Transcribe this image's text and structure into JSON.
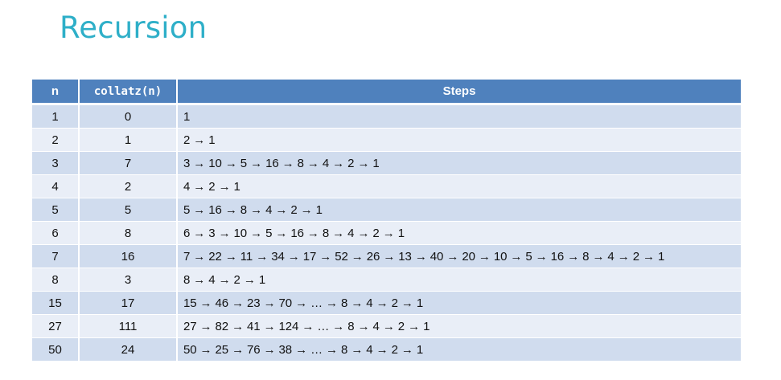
{
  "title": "Recursion",
  "table": {
    "headers": [
      "n",
      "collatz(n)",
      "Steps"
    ],
    "rows": [
      {
        "n": "1",
        "collatz": "0",
        "steps": "1"
      },
      {
        "n": "2",
        "collatz": "1",
        "steps": "2 → 1"
      },
      {
        "n": "3",
        "collatz": "7",
        "steps": "3 → 10 → 5 → 16 → 8 → 4 → 2 → 1"
      },
      {
        "n": "4",
        "collatz": "2",
        "steps": "4 → 2 → 1"
      },
      {
        "n": "5",
        "collatz": "5",
        "steps": "5 → 16 → 8 → 4 → 2 → 1"
      },
      {
        "n": "6",
        "collatz": "8",
        "steps": "6 → 3 → 10 → 5 → 16 → 8 → 4 → 2 → 1"
      },
      {
        "n": "7",
        "collatz": "16",
        "steps": "7 → 22 → 11 → 34 → 17 → 52 → 26 → 13 → 40 → 20 → 10 → 5 → 16 → 8 → 4 → 2 → 1"
      },
      {
        "n": "8",
        "collatz": "3",
        "steps": "8 → 4 → 2 → 1"
      },
      {
        "n": "15",
        "collatz": "17",
        "steps": "15 → 46 → 23 → 70 → … → 8 → 4 → 2 → 1"
      },
      {
        "n": "27",
        "collatz": "111",
        "steps": "27 → 82 → 41 → 124 → … → 8 → 4 → 2 → 1"
      },
      {
        "n": "50",
        "collatz": "24",
        "steps": "50 → 25 → 76 → 38 → … → 8 → 4 → 2 → 1"
      }
    ]
  }
}
